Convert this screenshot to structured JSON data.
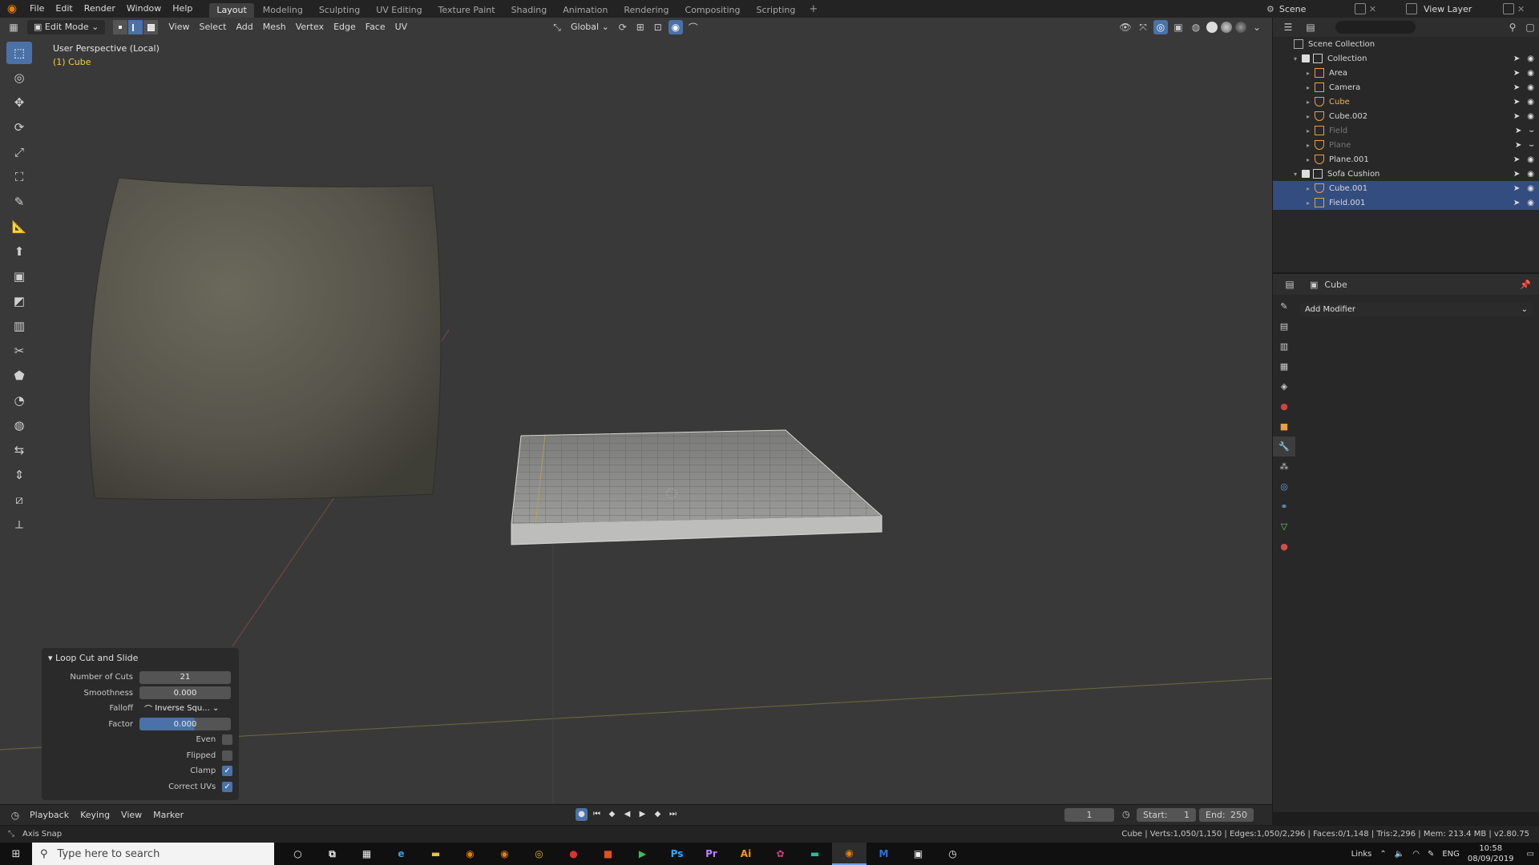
{
  "topbar": {
    "menus": [
      "File",
      "Edit",
      "Render",
      "Window",
      "Help"
    ],
    "workspaces": [
      "Layout",
      "Modeling",
      "Sculpting",
      "UV Editing",
      "Texture Paint",
      "Shading",
      "Animation",
      "Rendering",
      "Compositing",
      "Scripting"
    ],
    "active_workspace": "Layout",
    "scene": "Scene",
    "view_layer": "View Layer"
  },
  "viewport": {
    "mode": "Edit Mode",
    "menus": [
      "View",
      "Select",
      "Add",
      "Mesh",
      "Vertex",
      "Edge",
      "Face",
      "UV"
    ],
    "transform_orientation": "Global",
    "perspective_label": "User Perspective (Local)",
    "object_label": "(1) Cube",
    "colors": {
      "background": "#393939",
      "accent": "#4a72a8",
      "active_text": "#f0d040"
    }
  },
  "toolbar": {
    "tools": [
      "select-box-icon",
      "cursor-icon",
      "move-icon",
      "rotate-icon",
      "scale-icon",
      "transform-icon",
      "annotate-icon",
      "measure-icon",
      "extrude-icon",
      "inset-icon",
      "bevel-icon",
      "loop-cut-icon",
      "knife-icon",
      "poly-build-icon",
      "spin-icon",
      "smooth-icon",
      "edge-slide-icon",
      "shrink-fatten-icon",
      "shear-icon",
      "rip-icon"
    ]
  },
  "operator_panel": {
    "title": "Loop Cut and Slide",
    "number_of_cuts_label": "Number of Cuts",
    "number_of_cuts": "21",
    "smoothness_label": "Smoothness",
    "smoothness": "0.000",
    "falloff_label": "Falloff",
    "falloff": "Inverse Squ...",
    "factor_label": "Factor",
    "factor": "0.000",
    "even_label": "Even",
    "flipped_label": "Flipped",
    "clamp_label": "Clamp",
    "correct_uvs_label": "Correct UVs"
  },
  "outliner": {
    "root": "Scene Collection",
    "rows": [
      {
        "name": "Collection",
        "type": "collection",
        "indent": 1
      },
      {
        "name": "Area",
        "type": "light",
        "indent": 2
      },
      {
        "name": "Camera",
        "type": "camera",
        "indent": 2
      },
      {
        "name": "Cube",
        "type": "mesh",
        "indent": 2,
        "active": true
      },
      {
        "name": "Cube.002",
        "type": "mesh",
        "indent": 2
      },
      {
        "name": "Field",
        "type": "field",
        "indent": 2,
        "dim": true
      },
      {
        "name": "Plane",
        "type": "mesh",
        "indent": 2,
        "dim": true
      },
      {
        "name": "Plane.001",
        "type": "mesh",
        "indent": 2
      },
      {
        "name": "Sofa Cushion",
        "type": "collection",
        "indent": 1
      },
      {
        "name": "Cube.001",
        "type": "mesh",
        "indent": 2,
        "selected": true
      },
      {
        "name": "Field.001",
        "type": "field",
        "indent": 2,
        "selected": true
      }
    ]
  },
  "properties": {
    "object_name": "Cube",
    "add_modifier": "Add Modifier"
  },
  "timeline": {
    "menus": [
      "Playback",
      "Keying",
      "View",
      "Marker"
    ],
    "current_frame": "1",
    "start_label": "Start:",
    "start": "1",
    "end_label": "End:",
    "end": "250"
  },
  "statusbar": {
    "left": "Axis Snap",
    "right": "Cube | Verts:1,050/1,150 | Edges:1,050/2,296 | Faces:0/1,148 | Tris:2,296 | Mem: 213.4 MB | v2.80.75"
  },
  "taskbar": {
    "search_placeholder": "Type here to search",
    "tray_links": "Links",
    "language": "ENG",
    "time": "10:58",
    "date": "08/09/2019"
  }
}
